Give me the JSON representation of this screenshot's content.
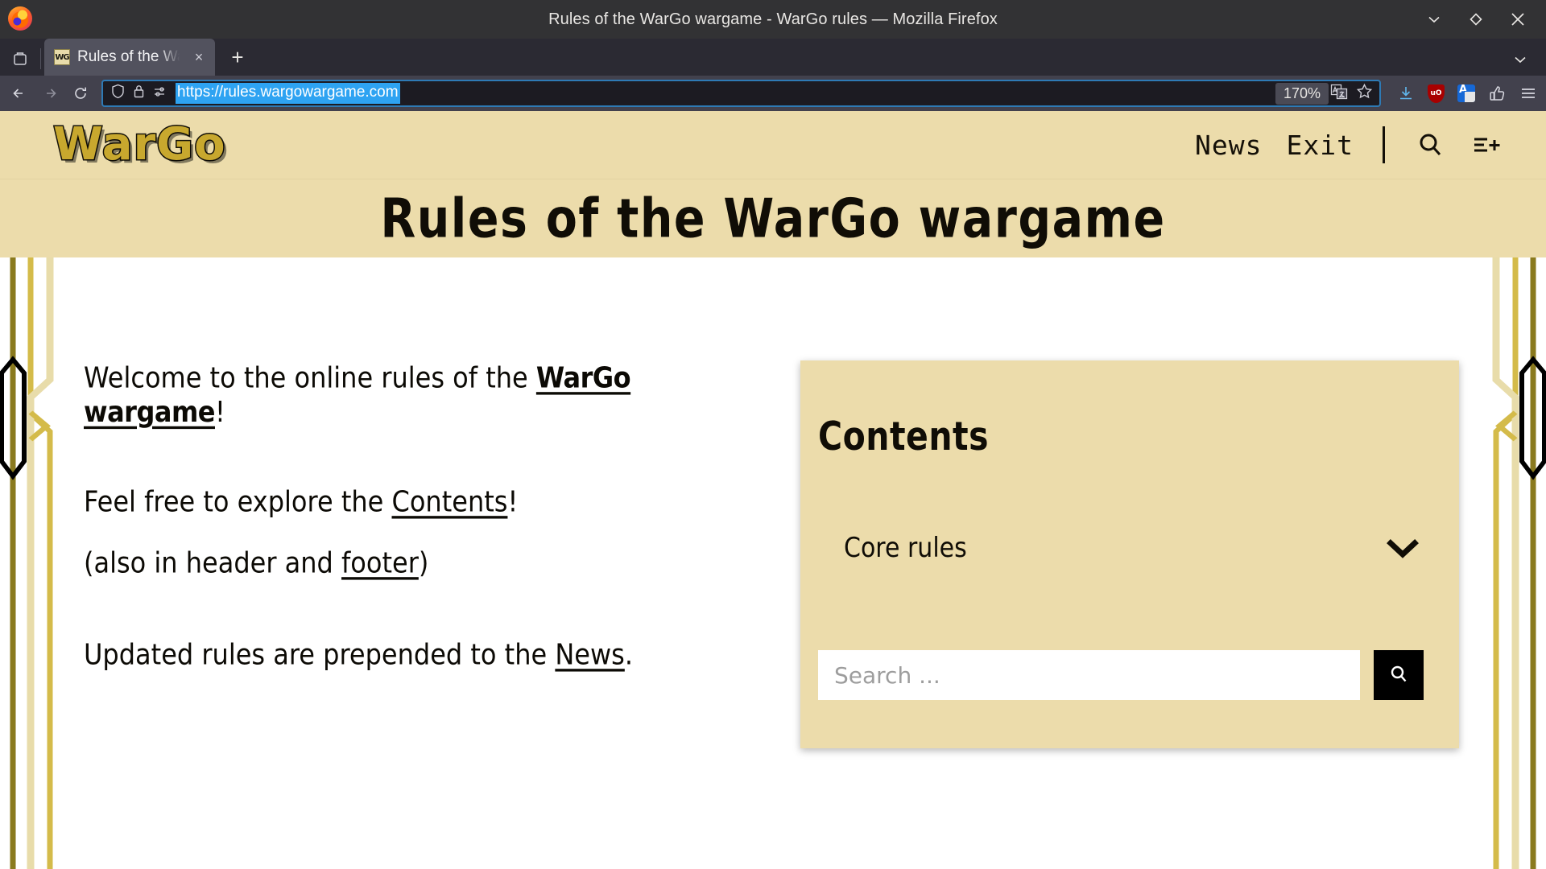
{
  "browser": {
    "window_title": "Rules of the WarGo wargame - WarGo rules — Mozilla Firefox",
    "tab": {
      "title": "Rules of the WarGo wargame",
      "favicon_name": "wargo-favicon",
      "close_label": "×"
    },
    "new_tab_label": "+",
    "url": "https://rules.wargowargame.com",
    "zoom_level": "170%",
    "toolbar_icons": [
      "back-icon",
      "forward-icon",
      "reload-icon",
      "shield-icon",
      "lock-icon",
      "permissions-icon",
      "translate-page-icon",
      "bookmark-star-icon",
      "downloads-icon",
      "ublock-origin-icon",
      "translate-extension-icon",
      "pocket-icon",
      "application-menu-icon"
    ],
    "ublock_badge": "uO"
  },
  "site": {
    "logo_text": "WarGo",
    "nav": {
      "links": [
        {
          "label": "News"
        },
        {
          "label": "Exit"
        }
      ],
      "search_icon": "search-icon",
      "menu_icon": "menu-expand-icon"
    },
    "page_title": "Rules of the WarGo wargame"
  },
  "main": {
    "paragraphs": {
      "p1_before": "Welcome to the online rules of the ",
      "p1_link_strong": "WarGo",
      "p1_link_rest": " wargame",
      "p1_after": "!",
      "p2_before": "Feel free to explore the ",
      "p2_link": "Contents",
      "p2_after": "!",
      "p3_before": "(also in header and ",
      "p3_link": "footer",
      "p3_after": ")",
      "p4_before": "Updated rules are prepended to the ",
      "p4_link": "News",
      "p4_after": "."
    }
  },
  "contents_panel": {
    "title": "Contents",
    "items": [
      {
        "label": "Core rules",
        "expander_icon": "chevron-down-icon"
      }
    ],
    "search": {
      "placeholder": "Search ...",
      "value": "",
      "button_icon": "search-icon"
    }
  },
  "colors": {
    "page_cream": "#ecdcab",
    "ink": "#100d06",
    "logo_gold": "#c8a82e",
    "rail_gold_dark": "#8a7a1e",
    "rail_gold": "#d4bb4a",
    "rail_gold_pale": "#e8dcaa",
    "urlbar_selection": "#2ea3f2",
    "chrome_dark": "#2b2a33"
  }
}
